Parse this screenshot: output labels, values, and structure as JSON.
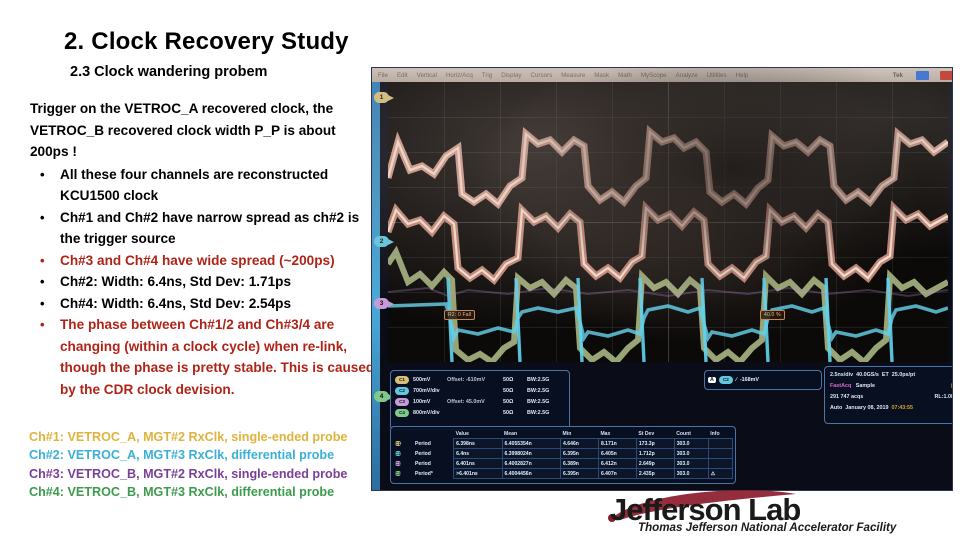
{
  "slide": {
    "title": "2. Clock Recovery Study",
    "subtitle": "2.3 Clock wandering probem"
  },
  "body": {
    "lead": "Trigger on the VETROC_A recovered clock, the VETROC_B recovered clock width P_P is about 200ps !",
    "bullet_char": "•",
    "bullets": [
      {
        "text": "All these four channels are reconstructed KCU1500 clock",
        "color": "black"
      },
      {
        "text": "Ch#1 and Ch#2 have narrow spread as ch#2 is the trigger source",
        "color": "black"
      },
      {
        "text": "Ch#3 and Ch#4 have wide spread (~200ps)",
        "color": "red"
      },
      {
        "text": "Ch#2: Width: 6.4ns, Std Dev: 1.71ps",
        "color": "black"
      },
      {
        "text": "Ch#4: Width: 6.4ns, Std Dev: 2.54ps",
        "color": "black"
      },
      {
        "text": "The phase between Ch#1/2 and Ch#3/4 are changing (within a clock cycle) when re-link, though the phase is pretty stable. This is caused by the CDR clock devision.",
        "color": "red"
      }
    ]
  },
  "legend": {
    "items": [
      {
        "text": "Ch#1: VETROC_A, MGT#2 RxClk, single-ended probe",
        "color": "#e0b33c"
      },
      {
        "text": "Ch#2: VETROC_A, MGT#3 RxClk, differential probe",
        "color": "#3bb0d6"
      },
      {
        "text": "Ch#3: VETROC_B, MGT#2 RxClk, single-ended probe",
        "color": "#7a3f96"
      },
      {
        "text": "Ch#4: VETROC_B, MGT#3 RxClk, differential probe",
        "color": "#3c9b4c"
      }
    ]
  },
  "scope": {
    "brand": "Tek",
    "menu": [
      "File",
      "Edit",
      "Vertical",
      "Horiz/Acq",
      "Trig",
      "Display",
      "Cursors",
      "Measure",
      "Mask",
      "Math",
      "MyScope",
      "Analyze",
      "Utilities",
      "Help"
    ],
    "channel_markers": [
      "1",
      "2",
      "3",
      "4"
    ],
    "cursors": [
      {
        "label": "R2: 0 Fall"
      },
      {
        "label": "40.0 %"
      }
    ],
    "vertical": [
      {
        "ch": "C1",
        "scale": "500mV",
        "offset": "Offset: -610mV",
        "imp": "50Ω",
        "bw": "BW:2.5G"
      },
      {
        "ch": "C2",
        "scale": "700mV/div",
        "offset": "",
        "imp": "50Ω",
        "bw": "BW:2.5G"
      },
      {
        "ch": "C3",
        "scale": "100mV",
        "offset": "Offset: 45.0mV",
        "imp": "50Ω",
        "bw": "BW:2.5G"
      },
      {
        "ch": "C4",
        "scale": "800mV/div",
        "offset": "",
        "imp": "50Ω",
        "bw": "BW:2.5G"
      }
    ],
    "trigger": {
      "src_badge": "A",
      "ch_badge": "C2",
      "slope": "∕",
      "level": "-168mV"
    },
    "acq": {
      "timebase": "2.5ns/div",
      "samplerate": "40.0GS/s",
      "mode": "ET",
      "resolution": "25.0ps/pt",
      "fastacq": "FastAcq",
      "sampling": "Sample",
      "acqs": "291 747 acqs",
      "reclen": "RL:1.0k",
      "trigmode": "Auto",
      "date": "January 08, 2019",
      "time": "07:43:55"
    },
    "measurements": {
      "columns": [
        "Value",
        "Mean",
        "Min",
        "Max",
        "St Dev",
        "Count",
        "Info"
      ],
      "rows": [
        {
          "ch": "C1",
          "name": "Period",
          "value": "6.398ns",
          "mean": "6.4055354n",
          "min": "4.646n",
          "max": "8.171n",
          "stdev": "173.3p",
          "count": "303.0",
          "info": ""
        },
        {
          "ch": "C2",
          "name": "Period",
          "value": "6.4ns",
          "mean": "6.3998024n",
          "min": "6.395n",
          "max": "6.405n",
          "stdev": "1.712p",
          "count": "303.0",
          "info": ""
        },
        {
          "ch": "C3",
          "name": "Period",
          "value": "6.401ns",
          "mean": "6.4002827n",
          "min": "6.389n",
          "max": "6.412n",
          "stdev": "2.649p",
          "count": "303.0",
          "info": ""
        },
        {
          "ch": "C4",
          "name": "Period*",
          "value": ">6.401ns",
          "mean": "6.4004456n",
          "min": "6.395n",
          "max": "6.407n",
          "stdev": "2.435p",
          "count": "303.0",
          "info": "⚠"
        }
      ]
    }
  },
  "logo": {
    "main": "Jefferson Lab",
    "tagline": "Thomas Jefferson National Accelerator Facility"
  }
}
